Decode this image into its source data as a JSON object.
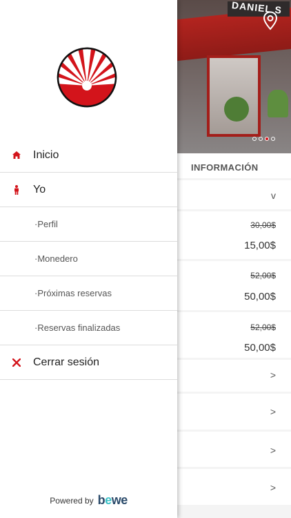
{
  "hero": {
    "sign_text": "DANIEL S",
    "pin_icon": "map-pin-icon",
    "carousel": {
      "total": 4,
      "active_index": 2
    }
  },
  "info_panel": {
    "header": "INFORMACIÓN",
    "top_chevron": "v",
    "items": [
      {
        "old_price": "30,00$",
        "new_price": "15,00$"
      },
      {
        "old_price": "52,00$",
        "new_price": "50,00$"
      },
      {
        "old_price": "52,00$",
        "new_price": "50,00$"
      }
    ],
    "chevrons": [
      ">",
      ">",
      ">",
      ">"
    ]
  },
  "drawer": {
    "logo": "sunburst-logo",
    "menu": [
      {
        "label": "Inicio",
        "icon": "home-icon"
      },
      {
        "label": "Yo",
        "icon": "person-icon"
      },
      {
        "label": "·Perfil"
      },
      {
        "label": "·Monedero"
      },
      {
        "label": "·Próximas reservas"
      },
      {
        "label": "·Reservas finalizadas"
      },
      {
        "label": "Cerrar sesión",
        "icon": "close-icon"
      }
    ],
    "footer": {
      "powered": "Powered by",
      "brand_a": "b",
      "brand_e": "e",
      "brand_b": "we"
    }
  },
  "colors": {
    "accent": "#d3141b",
    "divider": "#dcdcdc",
    "brand_dark": "#2a4a6a",
    "brand_teal": "#3ac1c7"
  }
}
